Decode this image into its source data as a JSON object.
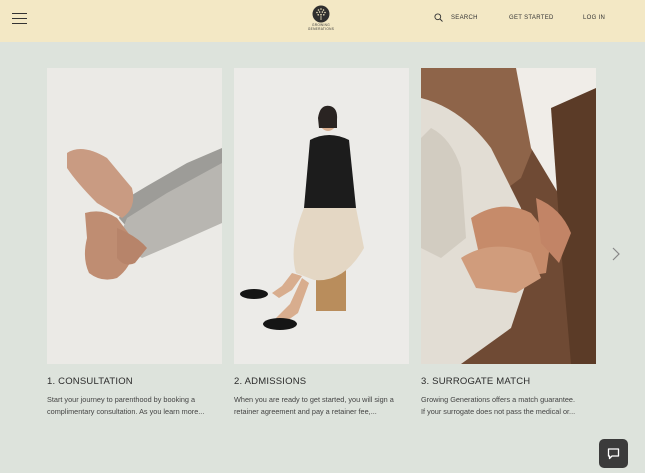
{
  "header": {
    "menu_icon": "hamburger-menu-icon",
    "logo_line1": "GROWING",
    "logo_line2": "GENERATIONS",
    "search_label": "SEARCH",
    "get_started_label": "GET STARTED",
    "login_label": "LOG IN"
  },
  "cards": [
    {
      "title": "1. CONSULTATION",
      "desc_line1": "Start your journey to parenthood by booking a",
      "desc_line2": "complimentary consultation. As you learn more..."
    },
    {
      "title": "2. ADMISSIONS",
      "desc_line1": "When you are ready to get started, you will sign a",
      "desc_line2": "retainer agreement and pay a retainer fee,..."
    },
    {
      "title": "3. SURROGATE MATCH",
      "desc_line1": "Growing Generations offers a match guarantee.",
      "desc_line2": "If your surrogate does not pass the medical or..."
    }
  ],
  "icons": {
    "next": "chevron-right-icon",
    "chat": "chat-bubble-icon",
    "search": "search-icon"
  },
  "colors": {
    "header_bg": "#f3e8c5",
    "page_bg": "#dde3dc",
    "chat_bg": "#3b3b3b"
  }
}
